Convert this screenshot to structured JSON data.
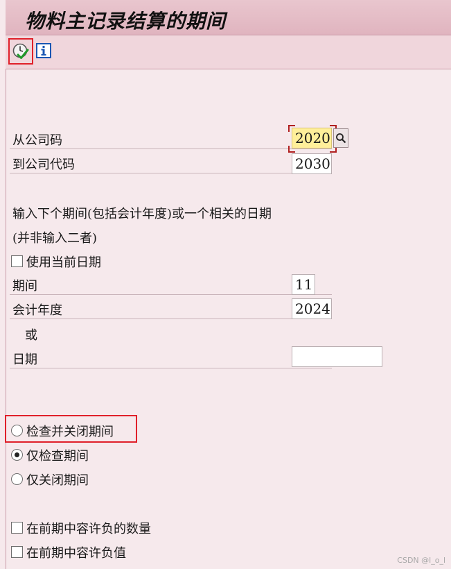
{
  "title": "物料主记录结算的期间",
  "toolbar": {
    "execute_icon": "execute-clock-check-icon",
    "info_icon": "info-icon"
  },
  "form": {
    "from_company_label": "从公司码",
    "from_company_value": "2020",
    "to_company_label": "到公司代码",
    "to_company_value": "2030",
    "hint_line1": "输入下个期间(包括会计年度)或一个相关的日期",
    "hint_line2": "(并非输入二者)",
    "use_current_date_label": "使用当前日期",
    "use_current_date_checked": false,
    "period_label": "期间",
    "period_value": "11",
    "fiscal_year_label": "会计年度",
    "fiscal_year_value": "2024",
    "or_label": "或",
    "date_label": "日期",
    "date_value": ""
  },
  "options": {
    "radio_check_and_close": "检查并关闭期间",
    "radio_check_only": "仅检查期间",
    "radio_close_only": "仅关闭期间",
    "selected": "check_only",
    "chk_negative_qty": "在前期中容许负的数量",
    "chk_negative_value": "在前期中容许负值",
    "chk_negative_qty_checked": false,
    "chk_negative_value_checked": false
  },
  "watermark": "CSDN @l_o_l",
  "colors": {
    "highlight": "#e0202a",
    "required_field": "#ffef9a",
    "background": "#f6e9ec"
  }
}
